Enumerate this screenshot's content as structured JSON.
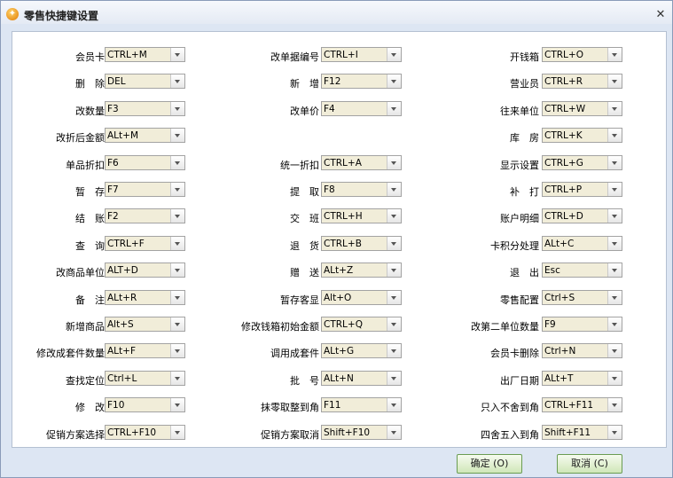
{
  "window": {
    "title": "零售快捷键设置"
  },
  "shortcuts": [
    [
      {
        "label": "会员卡",
        "value": "CTRL+M"
      },
      {
        "label": "改单据编号",
        "value": "CTRL+I"
      },
      {
        "label": "开钱箱",
        "value": "CTRL+O"
      }
    ],
    [
      {
        "label": "删　除",
        "value": "DEL"
      },
      {
        "label": "新　增",
        "value": "F12"
      },
      {
        "label": "营业员",
        "value": "CTRL+R"
      }
    ],
    [
      {
        "label": "改数量",
        "value": "F3"
      },
      {
        "label": "改单价",
        "value": "F4"
      },
      {
        "label": "往来单位",
        "value": "CTRL+W"
      }
    ],
    [
      {
        "label": "改折后金额",
        "value": "ALt+M"
      },
      {
        "label": "",
        "value": ""
      },
      {
        "label": "库　房",
        "value": "CTRL+K"
      }
    ],
    [
      {
        "label": "单品折扣",
        "value": "F6"
      },
      {
        "label": "统一折扣",
        "value": "CTRL+A"
      },
      {
        "label": "显示设置",
        "value": "CTRL+G"
      }
    ],
    [
      {
        "label": "暂　存",
        "value": "F7"
      },
      {
        "label": "提　取",
        "value": "F8"
      },
      {
        "label": "补　打",
        "value": "CTRL+P"
      }
    ],
    [
      {
        "label": "结　账",
        "value": "F2"
      },
      {
        "label": "交　班",
        "value": "CTRL+H"
      },
      {
        "label": "账户明细",
        "value": "CTRL+D"
      }
    ],
    [
      {
        "label": "查　询",
        "value": "CTRL+F"
      },
      {
        "label": "退　货",
        "value": "CTRL+B"
      },
      {
        "label": "卡积分处理",
        "value": "ALt+C"
      }
    ],
    [
      {
        "label": "改商品单位",
        "value": "ALT+D"
      },
      {
        "label": "赠　送",
        "value": "ALt+Z"
      },
      {
        "label": "退　出",
        "value": "Esc"
      }
    ],
    [
      {
        "label": "备　注",
        "value": "ALt+R"
      },
      {
        "label": "暂存客显",
        "value": "Alt+O"
      },
      {
        "label": "零售配置",
        "value": "Ctrl+S"
      }
    ],
    [
      {
        "label": "新增商品",
        "value": "Alt+S"
      },
      {
        "label": "修改钱箱初始金额",
        "value": "CTRL+Q"
      },
      {
        "label": "改第二单位数量",
        "value": "F9"
      }
    ],
    [
      {
        "label": "修改成套件数量",
        "value": "ALt+F"
      },
      {
        "label": "调用成套件",
        "value": "ALt+G"
      },
      {
        "label": "会员卡删除",
        "value": "Ctrl+N"
      }
    ],
    [
      {
        "label": "查找定位",
        "value": "Ctrl+L"
      },
      {
        "label": "批　号",
        "value": "ALt+N"
      },
      {
        "label": "出厂日期",
        "value": "ALt+T"
      }
    ],
    [
      {
        "label": "修　改",
        "value": "F10"
      },
      {
        "label": "抹零取整到角",
        "value": "F11"
      },
      {
        "label": "只入不舍到角",
        "value": "CTRL+F11"
      }
    ],
    [
      {
        "label": "促销方案选择",
        "value": "CTRL+F10"
      },
      {
        "label": "促销方案取消",
        "value": "Shift+F10"
      },
      {
        "label": "四舍五入到角",
        "value": "Shift+F11"
      }
    ]
  ],
  "footer": {
    "ok": "确定 (O)",
    "cancel": "取消 (C)"
  }
}
